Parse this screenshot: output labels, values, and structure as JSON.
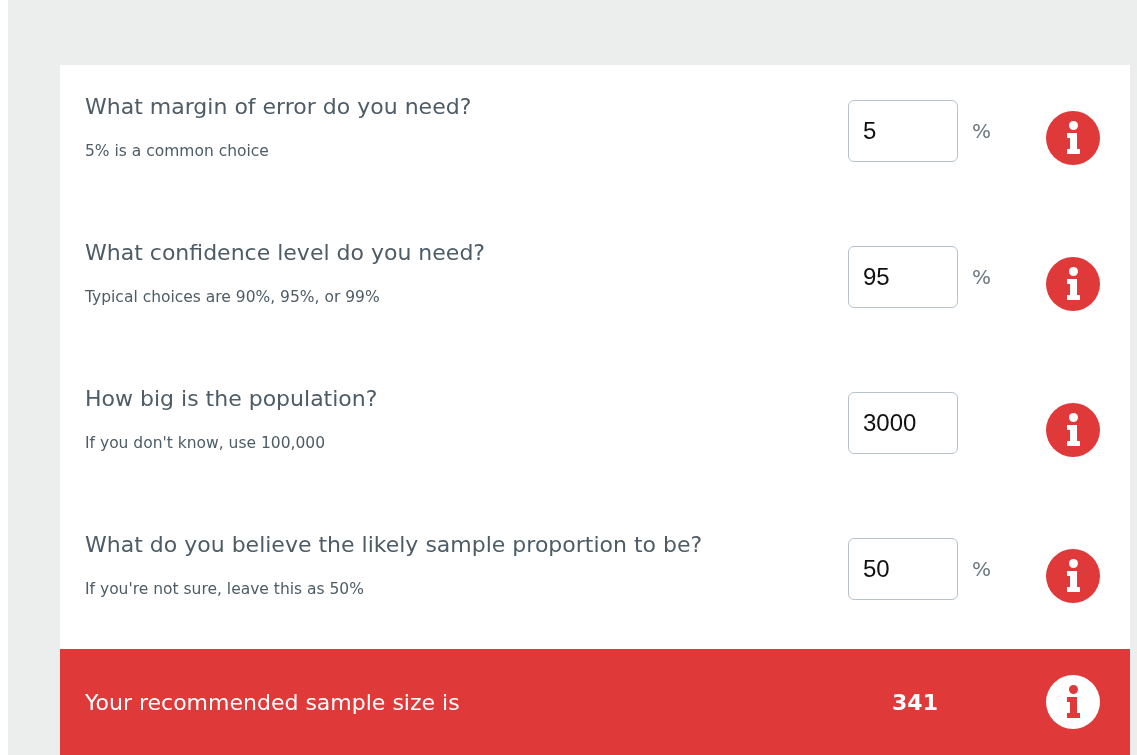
{
  "questions": [
    {
      "title": "What margin of error do you need?",
      "hint": "5% is a common choice",
      "value": "5",
      "unit": "%"
    },
    {
      "title": "What confidence level do you need?",
      "hint": "Typical choices are 90%, 95%, or 99%",
      "value": "95",
      "unit": "%"
    },
    {
      "title": "How big is the population?",
      "hint": "If you don't know, use 100,000",
      "value": "3000"
    },
    {
      "title": "What do you believe the likely sample proportion to be?",
      "hint": "If you're not sure, leave this as 50%",
      "value": "50",
      "unit": "%"
    }
  ],
  "result": {
    "label": "Your recommended sample size is",
    "value": "341"
  }
}
